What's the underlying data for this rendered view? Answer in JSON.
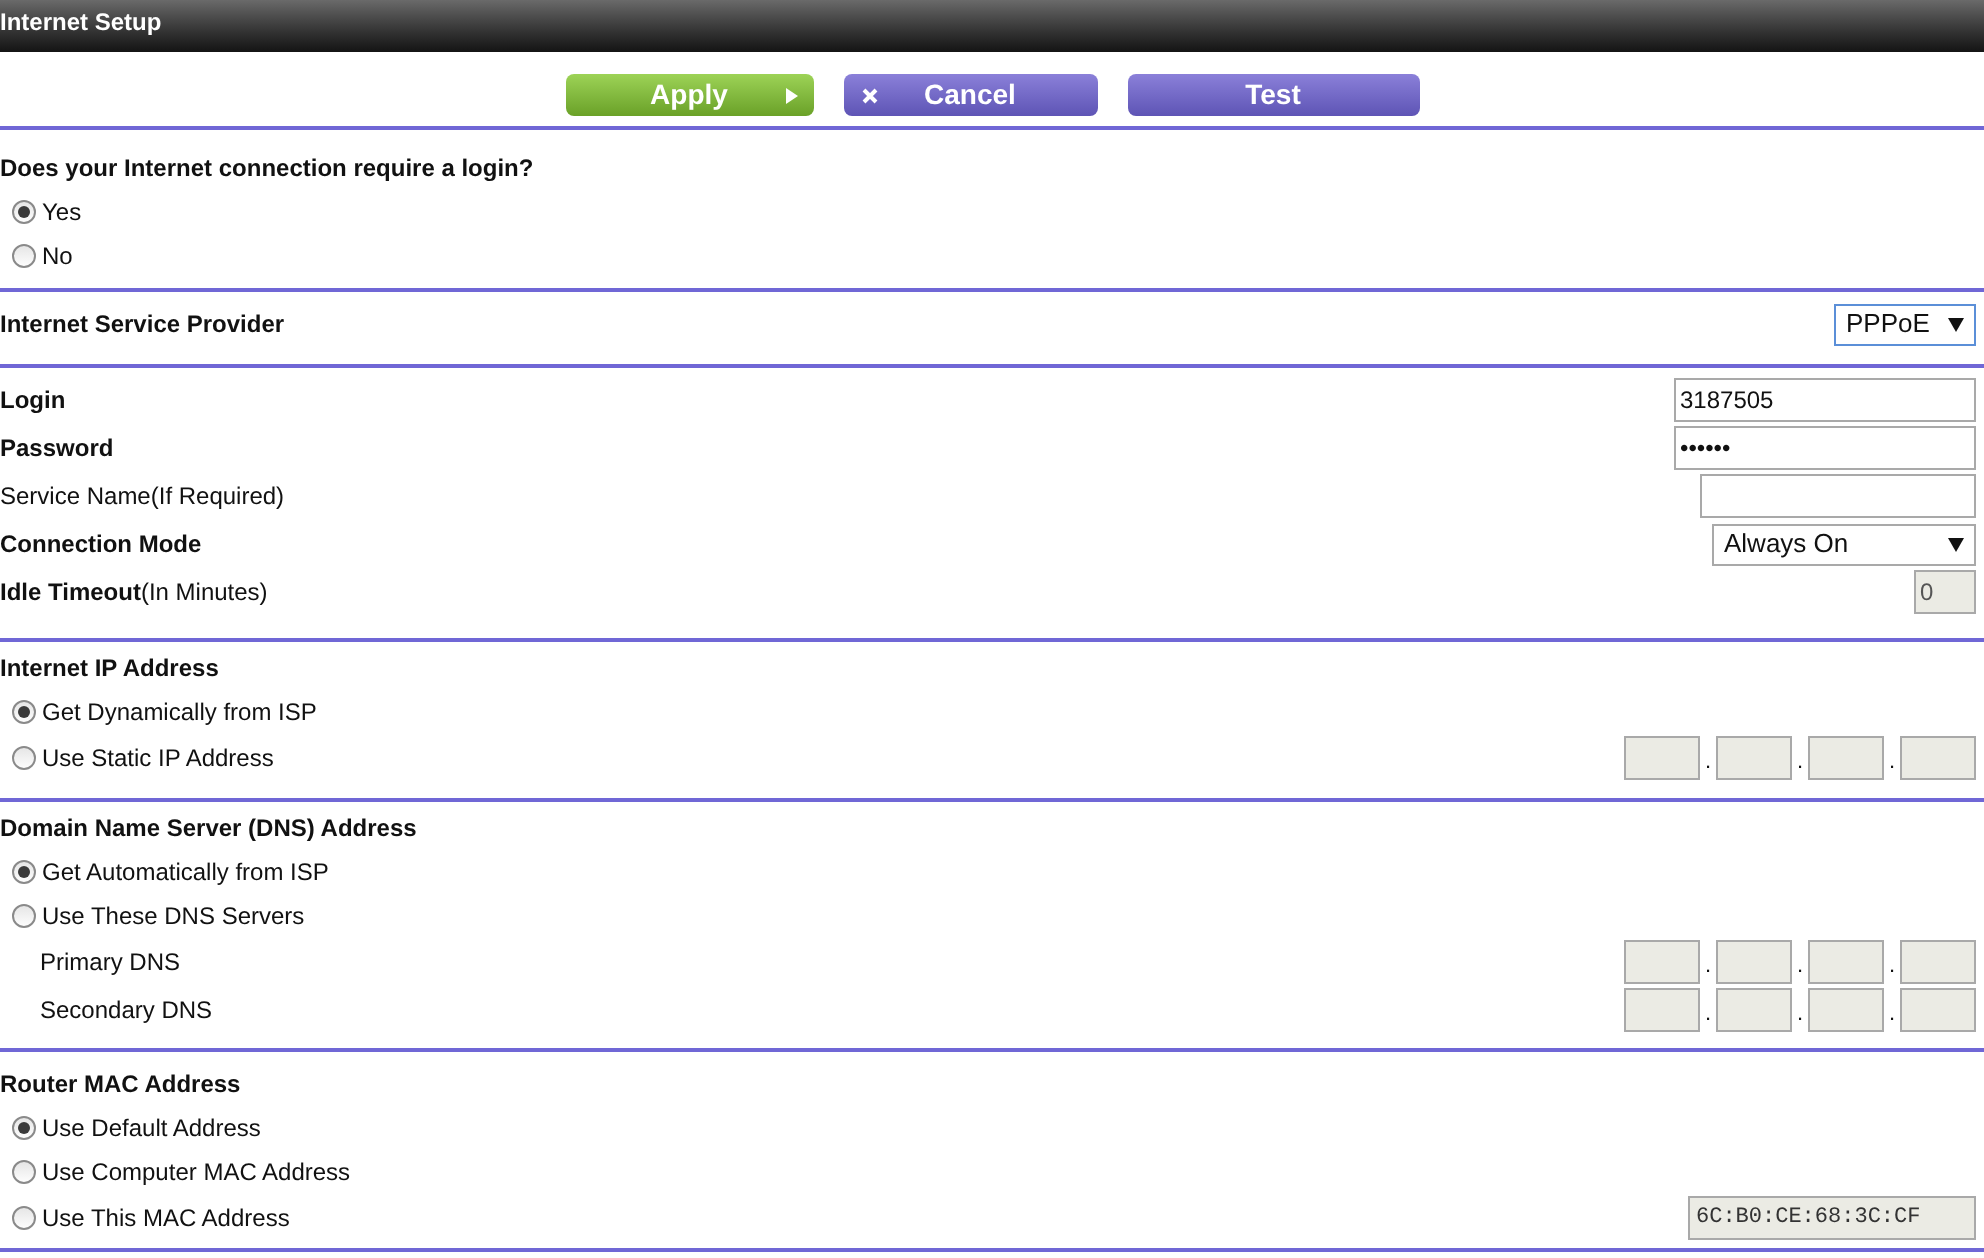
{
  "window": {
    "title": "Internet Setup"
  },
  "buttons": [
    {
      "label": "Apply",
      "kind": "apply"
    },
    {
      "label": "Cancel",
      "kind": "cancel"
    },
    {
      "label": "Test",
      "kind": "test"
    }
  ],
  "sections": [
    {
      "heading": "Does your Internet connection require a login?",
      "rows": [
        {
          "kind": "radio",
          "label": "Yes",
          "selected": true
        },
        {
          "kind": "radio",
          "label": "No",
          "selected": false
        }
      ]
    },
    {
      "rows": [
        {
          "kind": "select",
          "label": "Internet Service Provider",
          "bold": true,
          "value": "PPPoE"
        }
      ]
    },
    {
      "rows": [
        {
          "kind": "text",
          "label": "Login",
          "bold": true,
          "value": "3187505",
          "disabled": false
        },
        {
          "kind": "text",
          "label": "Password",
          "bold": true,
          "value": "••••••",
          "disabled": false
        },
        {
          "kind": "text",
          "label": "Service Name(If Required)",
          "bold": false,
          "disabled": false
        },
        {
          "kind": "select",
          "label": "Connection Mode",
          "bold": true,
          "value": "Always On"
        },
        {
          "kind": "text",
          "label": "**Idle Timeout**(In Minutes)",
          "bold": false,
          "value": "0",
          "disabled": true
        }
      ]
    },
    {
      "heading": "Internet IP Address",
      "rows": [
        {
          "kind": "radio",
          "label": "Get Dynamically from ISP",
          "selected": true
        },
        {
          "kind": "radio",
          "label": "Use Static IP Address",
          "selected": false,
          "ip": {
            "separator": ".",
            "boxes": [
              {
                "disabled": true
              },
              {
                "disabled": true
              },
              {
                "disabled": true
              },
              {
                "disabled": true
              }
            ]
          }
        }
      ]
    },
    {
      "heading": "Domain Name Server (DNS) Address",
      "rows": [
        {
          "kind": "radio",
          "label": "Get Automatically from ISP",
          "selected": true
        },
        {
          "kind": "radio",
          "label": "Use These DNS Servers",
          "selected": false
        },
        {
          "kind": "ip",
          "label": "Primary DNS",
          "ip": {
            "separator": ".",
            "boxes": [
              {
                "disabled": true
              },
              {
                "disabled": true
              },
              {
                "disabled": true
              },
              {
                "disabled": true
              }
            ]
          }
        },
        {
          "kind": "ip",
          "label": "Secondary DNS",
          "ip": {
            "separator": ".",
            "boxes": [
              {
                "disabled": true
              },
              {
                "disabled": true
              },
              {
                "disabled": true
              },
              {
                "disabled": true
              }
            ]
          }
        }
      ]
    },
    {
      "heading": "Router MAC Address",
      "rows": [
        {
          "kind": "radio",
          "label": "Use Default Address",
          "selected": true
        },
        {
          "kind": "radio",
          "label": "Use Computer MAC Address",
          "selected": false
        },
        {
          "kind": "radio",
          "label": "Use This MAC Address",
          "selected": false,
          "field": {
            "value": "6C:B0:CE:68:3C:CF",
            "disabled": true
          }
        }
      ]
    }
  ]
}
